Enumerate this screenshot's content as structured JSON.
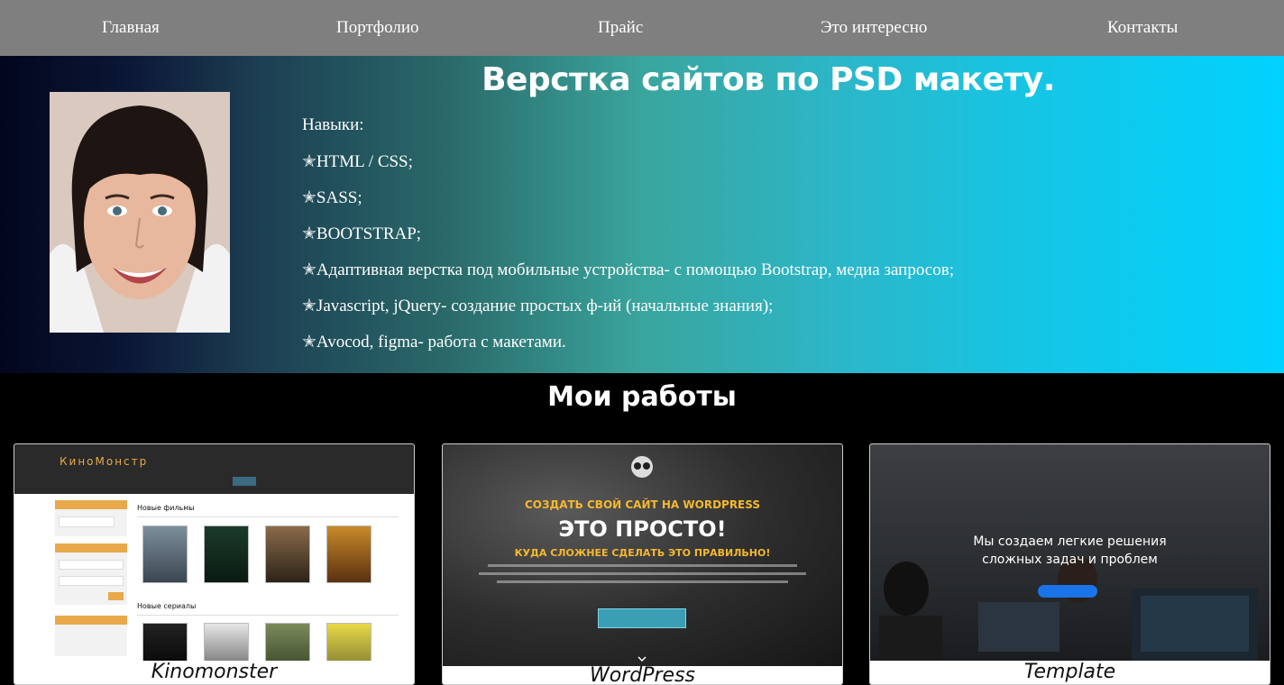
{
  "nav": {
    "items": [
      "Главная",
      "Портфолио",
      "Прайс",
      "Это интересно",
      "Контакты"
    ]
  },
  "hero": {
    "title": "Верстка сайтов по PSD макету.",
    "skills_label": "Навыки:",
    "skills": [
      "✭HTML / CSS;",
      "✭SASS;",
      "✭BOOTSTRAP;",
      "✭Адаптивная верстка под мобильные устройства- с помощью Bootstrap, медиа запросов;",
      "✭Javascript, jQuery- создание простых ф-ий (начальные знания);",
      "✭Avocod, figma- работа с макетами."
    ]
  },
  "works": {
    "title": "Мои работы",
    "cards": [
      {
        "caption": "Kinomonster",
        "logo": "КиноМонстр",
        "section_new_films": "Новые фильмы",
        "section_new_series": "Новые сериалы"
      },
      {
        "caption": "WordPress",
        "line1": "СОЗДАТЬ СВОЙ САЙТ НА WORDPRESS",
        "line2": "ЭТО ПРОСТО!",
        "line3": "КУДА СЛОЖНЕЕ СДЕЛАТЬ ЭТО ПРАВИЛЬНО!"
      },
      {
        "caption": "Template",
        "line1": "Мы создаем легкие решения",
        "line2": "сложных задач и проблем"
      }
    ]
  },
  "colors": {
    "nav_bg": "#7f7f7f",
    "hero_start": "#02061d",
    "hero_end": "#00d2ff",
    "accent_orange": "#e9a94b",
    "wp_yellow": "#f5b82e"
  }
}
